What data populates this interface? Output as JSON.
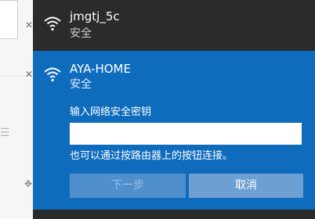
{
  "networks": [
    {
      "ssid": "jmgtj_5c",
      "status": "安全"
    },
    {
      "ssid": "AYA-HOME",
      "status": "安全",
      "prompt": "输入网络安全密钥",
      "key_value": "",
      "hint": "也可以通过按路由器上的按钮连接。",
      "next_label": "下一步",
      "cancel_label": "取消"
    }
  ],
  "colors": {
    "panel_bg": "#2b2b2b",
    "accent": "#0f6cbd",
    "button_disabled": "#4f8fcc",
    "button": "#6c9fd2"
  },
  "icons": {
    "network": "wifi-signal-icon",
    "background_close": "close-icon",
    "background_list": "list-icon",
    "background_move": "move-icon"
  }
}
